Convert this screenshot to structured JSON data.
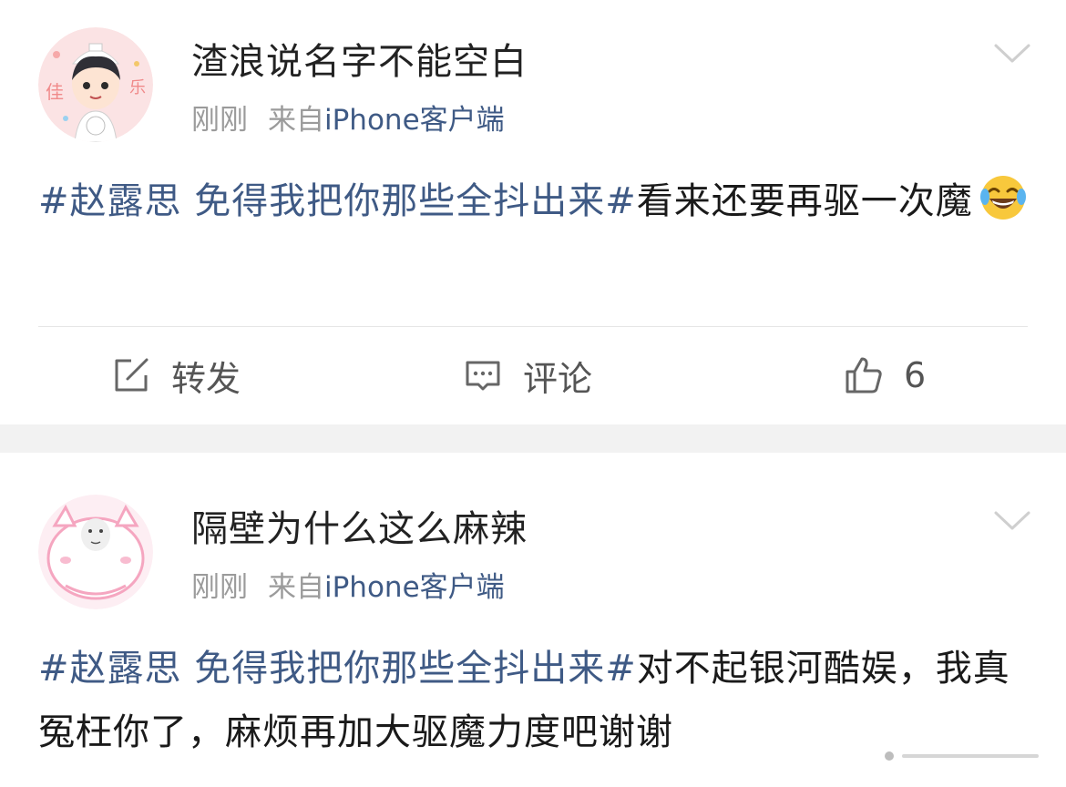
{
  "posts": [
    {
      "username": "渣浪说名字不能空白",
      "time": "刚刚",
      "source_prefix": "来自",
      "source_app": "iPhone客户端",
      "topic": "#赵露思 免得我把你那些全抖出来#",
      "text": "看来还要再驱一次魔",
      "emoji": "laughing-tears",
      "actions": {
        "repost": "转发",
        "comment": "评论",
        "like_count": "6"
      }
    },
    {
      "username": "隔壁为什么这么麻辣",
      "time": "刚刚",
      "source_prefix": "来自",
      "source_app": "iPhone客户端",
      "topic": "#赵露思 免得我把你那些全抖出来#",
      "text": "对不起银河酷娱，我真冤枉你了，麻烦再加大驱魔力度吧谢谢"
    }
  ],
  "colors": {
    "link": "#3f5a85",
    "meta": "#9b9b9b",
    "separator": "#f2f2f2"
  }
}
